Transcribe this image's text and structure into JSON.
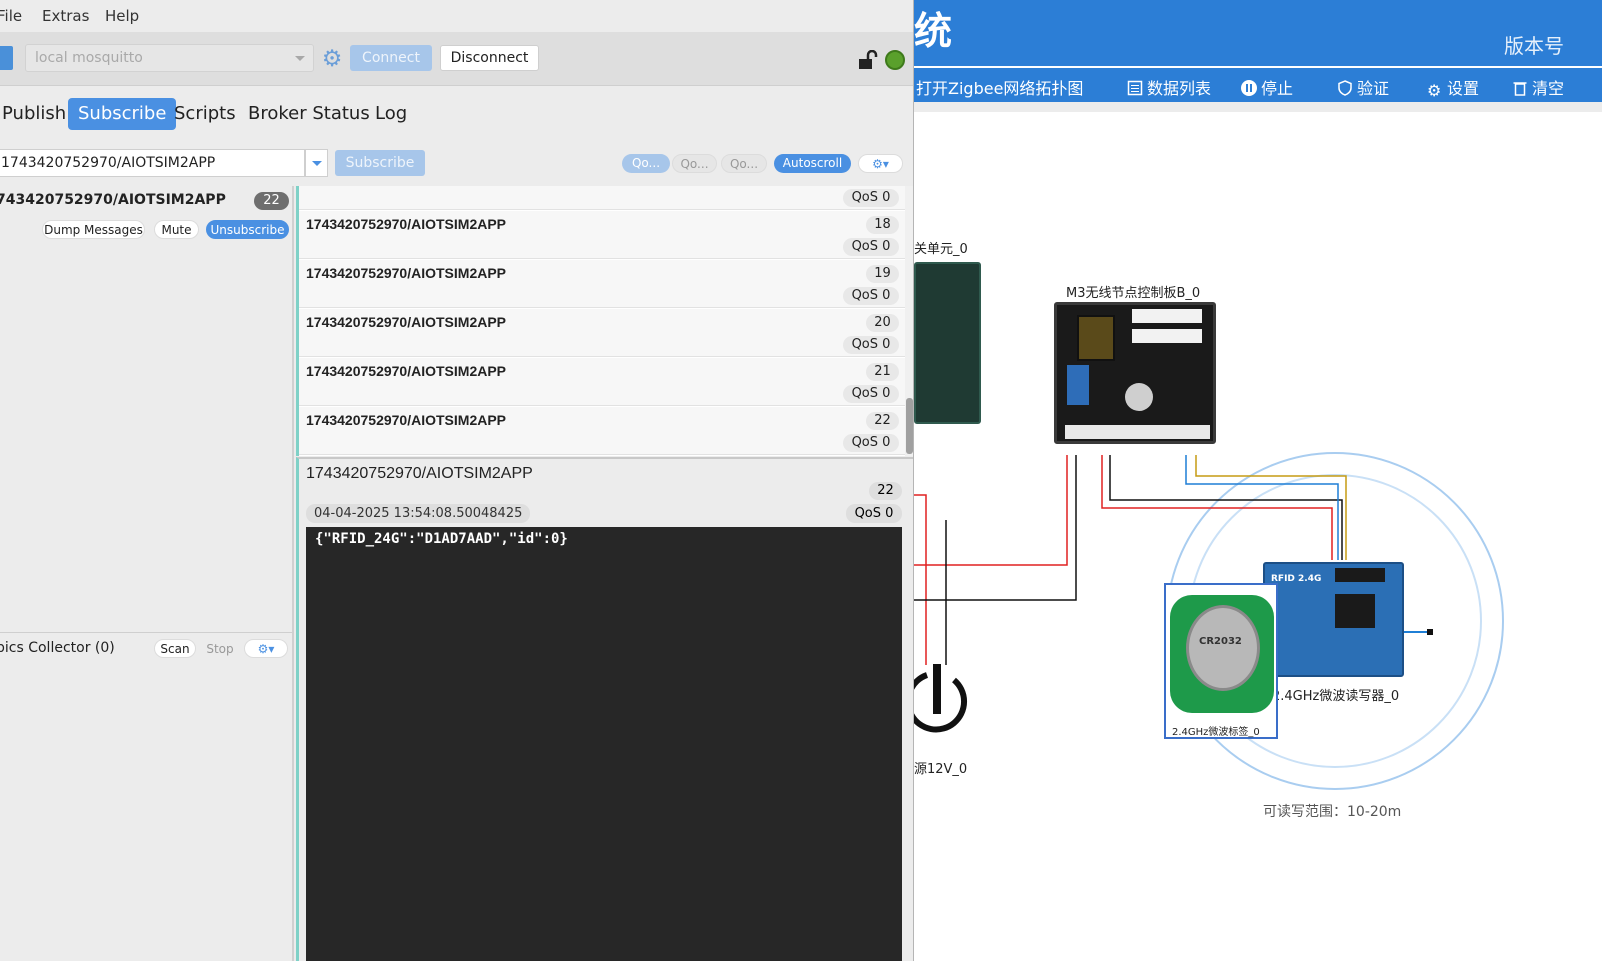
{
  "menu": {
    "file": "File",
    "extras": "Extras",
    "help": "Help"
  },
  "toolbar": {
    "broker": "local mosquitto",
    "connect": "Connect",
    "disconnect": "Disconnect"
  },
  "tabs": [
    "Publish",
    "Subscribe",
    "Scripts",
    "Broker Status",
    "Log"
  ],
  "subscribe_bar": {
    "topic": "1743420752970/AIOTSIM2APP",
    "subscribe_label": "Subscribe",
    "qos_pills": [
      "Qo...",
      "Qo...",
      "Qo..."
    ],
    "autoscroll": "Autoscroll",
    "options_icon": "gear-dropdown-icon"
  },
  "subscriptions": {
    "topic": "743420752970/AIOTSIM2APP",
    "count": "22",
    "dump": "Dump Messages",
    "mute": "Mute",
    "unsubscribe": "Unsubscribe"
  },
  "collector": {
    "title": "pics Collector (0)",
    "scan": "Scan",
    "stop": "Stop"
  },
  "messages": [
    {
      "topic": "",
      "count": "",
      "qos": "QoS 0"
    },
    {
      "topic": "1743420752970/AIOTSIM2APP",
      "count": "18",
      "qos": "QoS 0"
    },
    {
      "topic": "1743420752970/AIOTSIM2APP",
      "count": "19",
      "qos": "QoS 0"
    },
    {
      "topic": "1743420752970/AIOTSIM2APP",
      "count": "20",
      "qos": "QoS 0"
    },
    {
      "topic": "1743420752970/AIOTSIM2APP",
      "count": "21",
      "qos": "QoS 0"
    },
    {
      "topic": "1743420752970/AIOTSIM2APP",
      "count": "22",
      "qos": "QoS 0"
    }
  ],
  "detail": {
    "topic": "1743420752970/AIOTSIM2APP",
    "count": "22",
    "timestamp": "04-04-2025  13:54:08.50048425",
    "qos": "QoS 0",
    "payload": "{\"RFID_24G\":\"D1AD7AAD\",\"id\":0}"
  },
  "sim": {
    "title": "统",
    "version": "版本号",
    "toolbar": [
      "打开Zigbee网络拓扑图",
      "数据列表",
      "停止",
      "验证",
      "设置",
      "清空"
    ],
    "labels": {
      "gateway": "关单元_0",
      "controller": "M3无线节点控制板B_0",
      "power": "源12V_0",
      "reader": "2.4GHz微波读写器_0",
      "tag": "2.4GHz微波标签_0",
      "range": "可读写范围：10-20m",
      "reader_board": "RFID 2.4G",
      "battery": "CR2032"
    }
  },
  "colors": {
    "accent": "#4a90e2",
    "sim_header": "#2c7ed6",
    "connected": "#5aa02c",
    "payload_bg": "#272727"
  }
}
